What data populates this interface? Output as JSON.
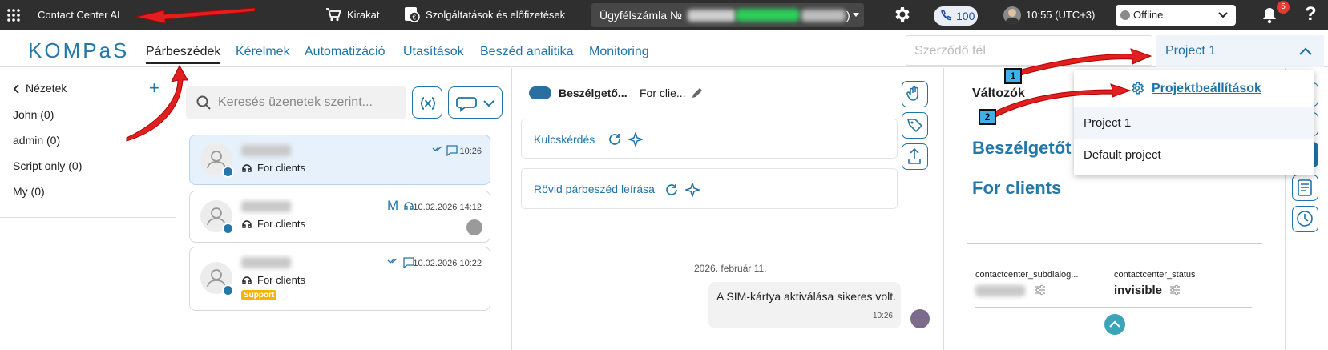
{
  "topbar": {
    "app_title": "Contact Center AI",
    "kirakat": "Kirakat",
    "services": "Szolgáltatások és előfizetések",
    "account_label": "Ügyfélszámla №",
    "account_suffix": ")",
    "calls_count": "100",
    "time": "10:55 (UTC+3)",
    "status": "Offline",
    "notifications": "5",
    "help": "?"
  },
  "nav": {
    "logo": "KOMPaS",
    "tabs": [
      "Párbeszédek",
      "Kérelmek",
      "Automatizáció",
      "Utasítások",
      "Beszéd analitika",
      "Monitoring"
    ],
    "party_placeholder": "Szerződő fél",
    "project": "Project 1"
  },
  "views": {
    "title": "Nézetek",
    "items": [
      "John (0)",
      "admin (0)",
      "Script only (0)",
      "My (0)"
    ]
  },
  "search": {
    "placeholder": "Keresés üzenetek szerint..."
  },
  "conversations": [
    {
      "tag": "For clients",
      "time": "10:26",
      "badge": ""
    },
    {
      "tag": "For clients",
      "time": "10.02.2026 14:12",
      "badge": ""
    },
    {
      "tag": "For clients",
      "time": "10.02.2026 10:22",
      "badge": "Support"
    }
  ],
  "dialog": {
    "title": "Beszélgető...",
    "subtitle": "For clie...",
    "key_question": "Kulcskérdés",
    "short_desc": "Rövid párbeszéd leírása",
    "date": "2026. február 11.",
    "message": "A SIM-kártya aktiválása sikeres volt.",
    "message_time": "10:26"
  },
  "right": {
    "variables": "Változók",
    "big1": "Beszélgetőt",
    "big2": "For clients",
    "var1_name": "contactcenter_subdialog...",
    "var2_name": "contactcenter_status",
    "var2_value": "invisible"
  },
  "dropdown": {
    "settings": "Projektbeállítások",
    "items": [
      "Project 1",
      "Default project"
    ]
  },
  "annotations": {
    "n1": "1",
    "n2": "2"
  },
  "colors": {
    "accent": "#1f74a8",
    "topbar": "#2f2f2f",
    "arrow": "#e02020"
  }
}
